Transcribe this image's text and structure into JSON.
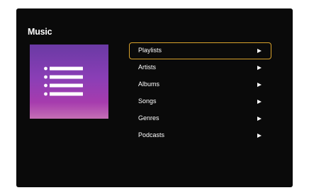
{
  "screen": {
    "title": "Music",
    "artwork_icon": "list-icon",
    "menu": {
      "selected_index": 0,
      "selected_color": "#d9a22c",
      "items": [
        {
          "label": "Playlists",
          "icon": "chevron-right-icon"
        },
        {
          "label": "Artists",
          "icon": "chevron-right-icon"
        },
        {
          "label": "Albums",
          "icon": "chevron-right-icon"
        },
        {
          "label": "Songs",
          "icon": "chevron-right-icon"
        },
        {
          "label": "Genres",
          "icon": "chevron-right-icon"
        },
        {
          "label": "Podcasts",
          "icon": "chevron-right-icon"
        }
      ]
    }
  }
}
